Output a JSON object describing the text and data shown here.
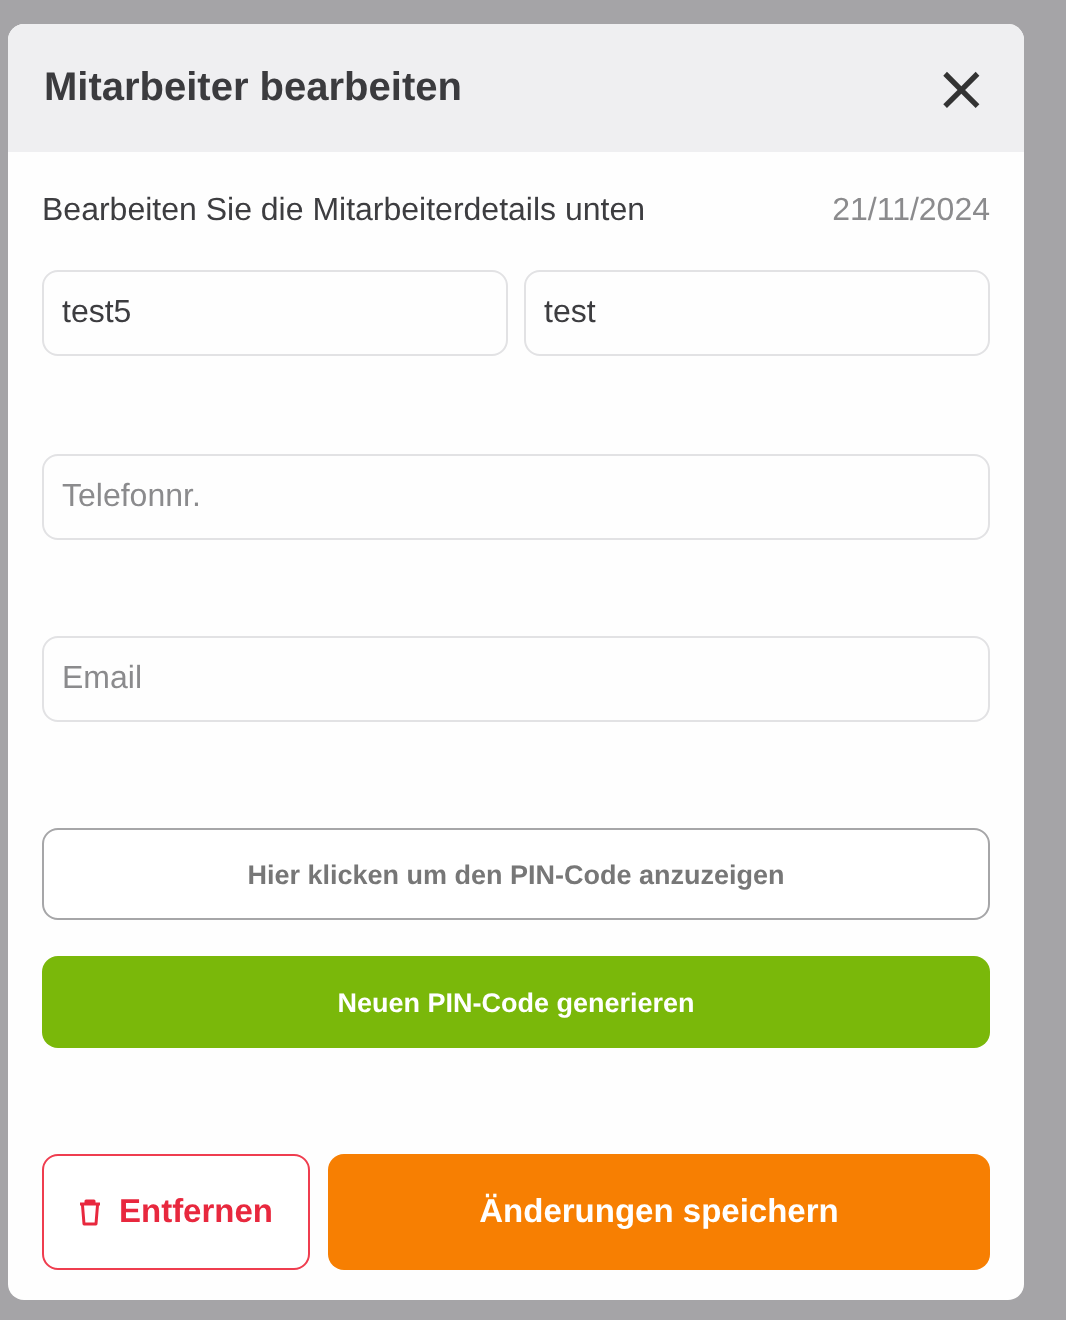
{
  "dialog": {
    "title": "Mitarbeiter bearbeiten",
    "close": "×"
  },
  "subtitle": "Bearbeiten Sie die Mitarbeiterdetails unten",
  "date": "21/11/2024",
  "name_fields": [
    {
      "value": "test5"
    },
    {
      "value": "test"
    }
  ],
  "fields": [
    {
      "placeholder": "Telefonnr."
    },
    {
      "placeholder": "Email"
    }
  ],
  "pin_buttons": [
    {
      "label": "Hier klicken um den PIN-Code anzuzeigen",
      "kind": "outline"
    },
    {
      "label": "Neuen PIN-Code generieren",
      "kind": "primary"
    }
  ],
  "footer": {
    "remove": "Entfernen",
    "save": "Änderungen speichern"
  }
}
